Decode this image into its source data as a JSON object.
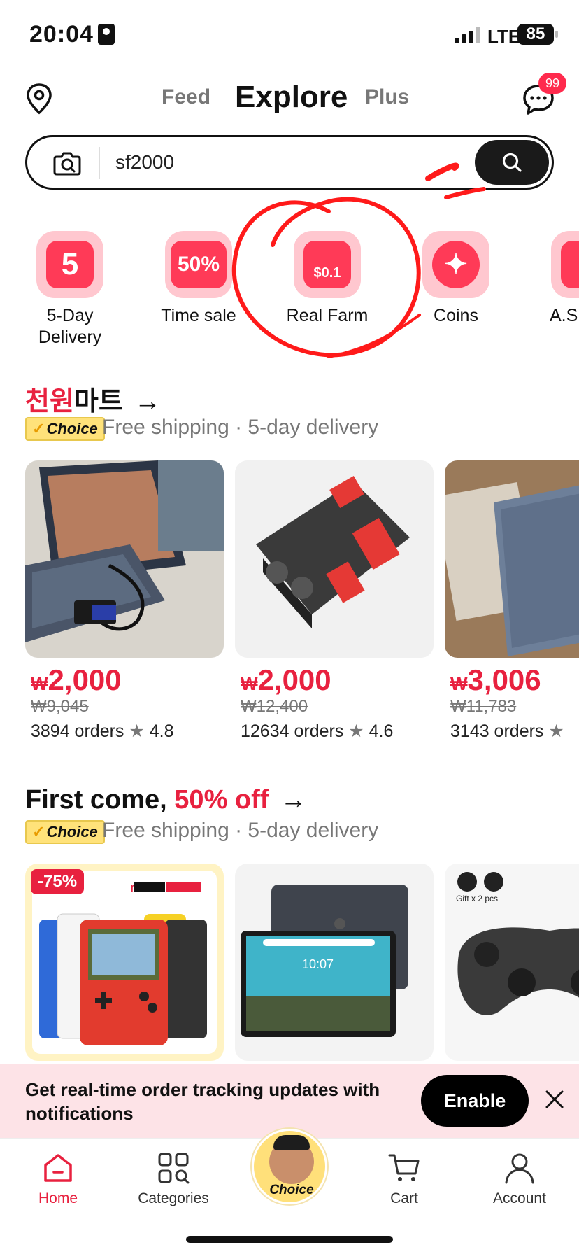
{
  "status_bar": {
    "time": "20:04",
    "network": "LTE",
    "battery": "85"
  },
  "header": {
    "tabs": [
      {
        "label": "Feed",
        "active": false
      },
      {
        "label": "Explore",
        "active": true
      },
      {
        "label": "Plus",
        "active": false
      }
    ],
    "message_badge": "99"
  },
  "search": {
    "value": "sf2000"
  },
  "quick_categories": [
    {
      "label": "5-Day Delivery",
      "icon": "5"
    },
    {
      "label": "Time sale",
      "icon": "50%"
    },
    {
      "label": "Real Farm",
      "icon": "$0.1"
    },
    {
      "label": "Coins",
      "icon": "✦"
    },
    {
      "label": "A.S",
      "icon": ""
    }
  ],
  "section_mart": {
    "title_red": "천원",
    "title_black": "마트",
    "arrow": "→",
    "badge": "Choice",
    "subtitle": "Free shipping · 5-day delivery",
    "products": [
      {
        "currency": "₩",
        "price": "2,000",
        "original": "₩9,045",
        "orders": "3894 orders",
        "rating": "4.8"
      },
      {
        "currency": "₩",
        "price": "2,000",
        "original": "₩12,400",
        "orders": "12634 orders",
        "rating": "4.6"
      },
      {
        "currency": "₩",
        "price": "3,006",
        "original": "₩11,783",
        "orders": "3143 orders",
        "rating": ""
      }
    ]
  },
  "section_first": {
    "title_black": "First come,",
    "title_red": "50% off",
    "arrow": "→",
    "badge": "Choice",
    "subtitle": "Free shipping · 5-day delivery",
    "products": [
      {
        "discount": "-75%"
      },
      {
        "discount": ""
      },
      {
        "discount": ""
      }
    ]
  },
  "notification": {
    "text": "Get real-time order tracking updates with notifications",
    "button": "Enable"
  },
  "bottom_nav": {
    "items": [
      {
        "label": "Home",
        "active": true
      },
      {
        "label": "Categories",
        "active": false
      },
      {
        "label": "Choice",
        "active": false
      },
      {
        "label": "Cart",
        "active": false
      },
      {
        "label": "Account",
        "active": false
      }
    ]
  },
  "colors": {
    "accent": "#e8213f",
    "choice_yellow": "#ffe27a",
    "dark": "#1a1a1a"
  }
}
